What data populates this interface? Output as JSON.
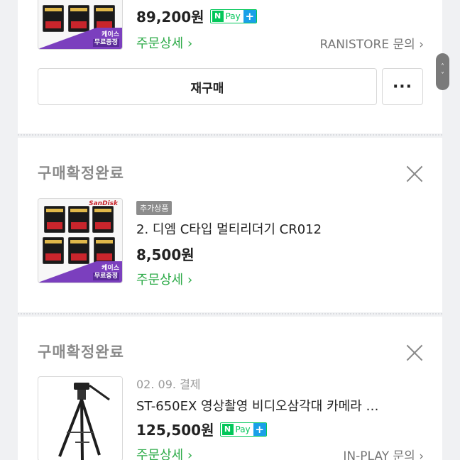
{
  "orders": [
    {
      "price": "89,200원",
      "npay": {
        "n": "N",
        "pay": "Pay",
        "plus": "+"
      },
      "detail_link": "주문상세",
      "seller_link": "RANISTORE 문의",
      "chevron": "›",
      "buttons": {
        "rebuy": "재구매",
        "more": "···"
      },
      "thumb_promo": {
        "line1": "케이스",
        "line2": "무료증정"
      }
    },
    {
      "status": "구매확정완료",
      "badge": "추가상품",
      "product_name": "2. 디엠 C타입 멀티리더기 CR012",
      "price": "8,500원",
      "detail_link": "주문상세",
      "chevron": "›",
      "thumb_logo": "SanDisk",
      "thumb_promo": {
        "line1": "케이스",
        "line2": "무료증정"
      }
    },
    {
      "status": "구매확정완료",
      "date": "02. 09. 결제",
      "product_name": "ST-650EX 영상촬영 비디오삼각대 카메라 …",
      "price": "125,500원",
      "npay": {
        "n": "N",
        "pay": "Pay",
        "plus": "+"
      },
      "detail_link": "주문상세",
      "seller_link": "IN-PLAY 문의",
      "chevron": "›"
    }
  ],
  "scroll_handle": {
    "up": "˄",
    "down": "˅"
  },
  "colors": {
    "accent_green": "#2eab49",
    "npay_green": "#03c75a",
    "npay_blue": "#1aa0e8",
    "promo_purple": "#7b3fbe"
  }
}
